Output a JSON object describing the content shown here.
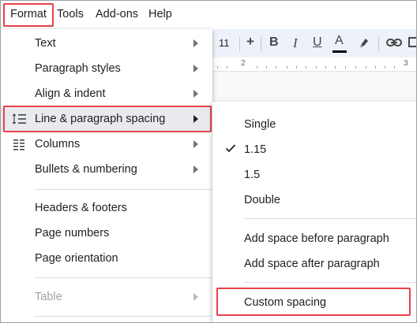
{
  "menubar": {
    "items": [
      "Format",
      "Tools",
      "Add-ons",
      "Help"
    ],
    "active": "Format"
  },
  "toolbar": {
    "font_size": "11",
    "increase_label": "+",
    "bold_label": "B",
    "italic_label": "I",
    "underline_label": "U",
    "text_color_label": "A"
  },
  "ruler": {
    "numbers": [
      "2",
      "3"
    ]
  },
  "format_menu": {
    "items": [
      {
        "label": "Text",
        "submenu": true
      },
      {
        "label": "Paragraph styles",
        "submenu": true
      },
      {
        "label": "Align & indent",
        "submenu": true
      },
      {
        "label": "Line & paragraph spacing",
        "submenu": true,
        "active": true,
        "icon": "line-spacing-icon"
      },
      {
        "label": "Columns",
        "submenu": true,
        "icon": "columns-icon"
      },
      {
        "label": "Bullets & numbering",
        "submenu": true
      },
      {
        "label": "Headers & footers"
      },
      {
        "label": "Page numbers"
      },
      {
        "label": "Page orientation"
      },
      {
        "label": "Table",
        "submenu": true,
        "disabled": true
      }
    ]
  },
  "spacing_submenu": {
    "items": [
      {
        "label": "Single"
      },
      {
        "label": "1.15",
        "checked": true
      },
      {
        "label": "1.5"
      },
      {
        "label": "Double"
      },
      {
        "label": "Add space before paragraph"
      },
      {
        "label": "Add space after paragraph"
      },
      {
        "label": "Custom spacing",
        "highlighted": true
      }
    ]
  },
  "colors": {
    "highlight_border": "#e8424b",
    "text_color_bar": "#000000"
  }
}
